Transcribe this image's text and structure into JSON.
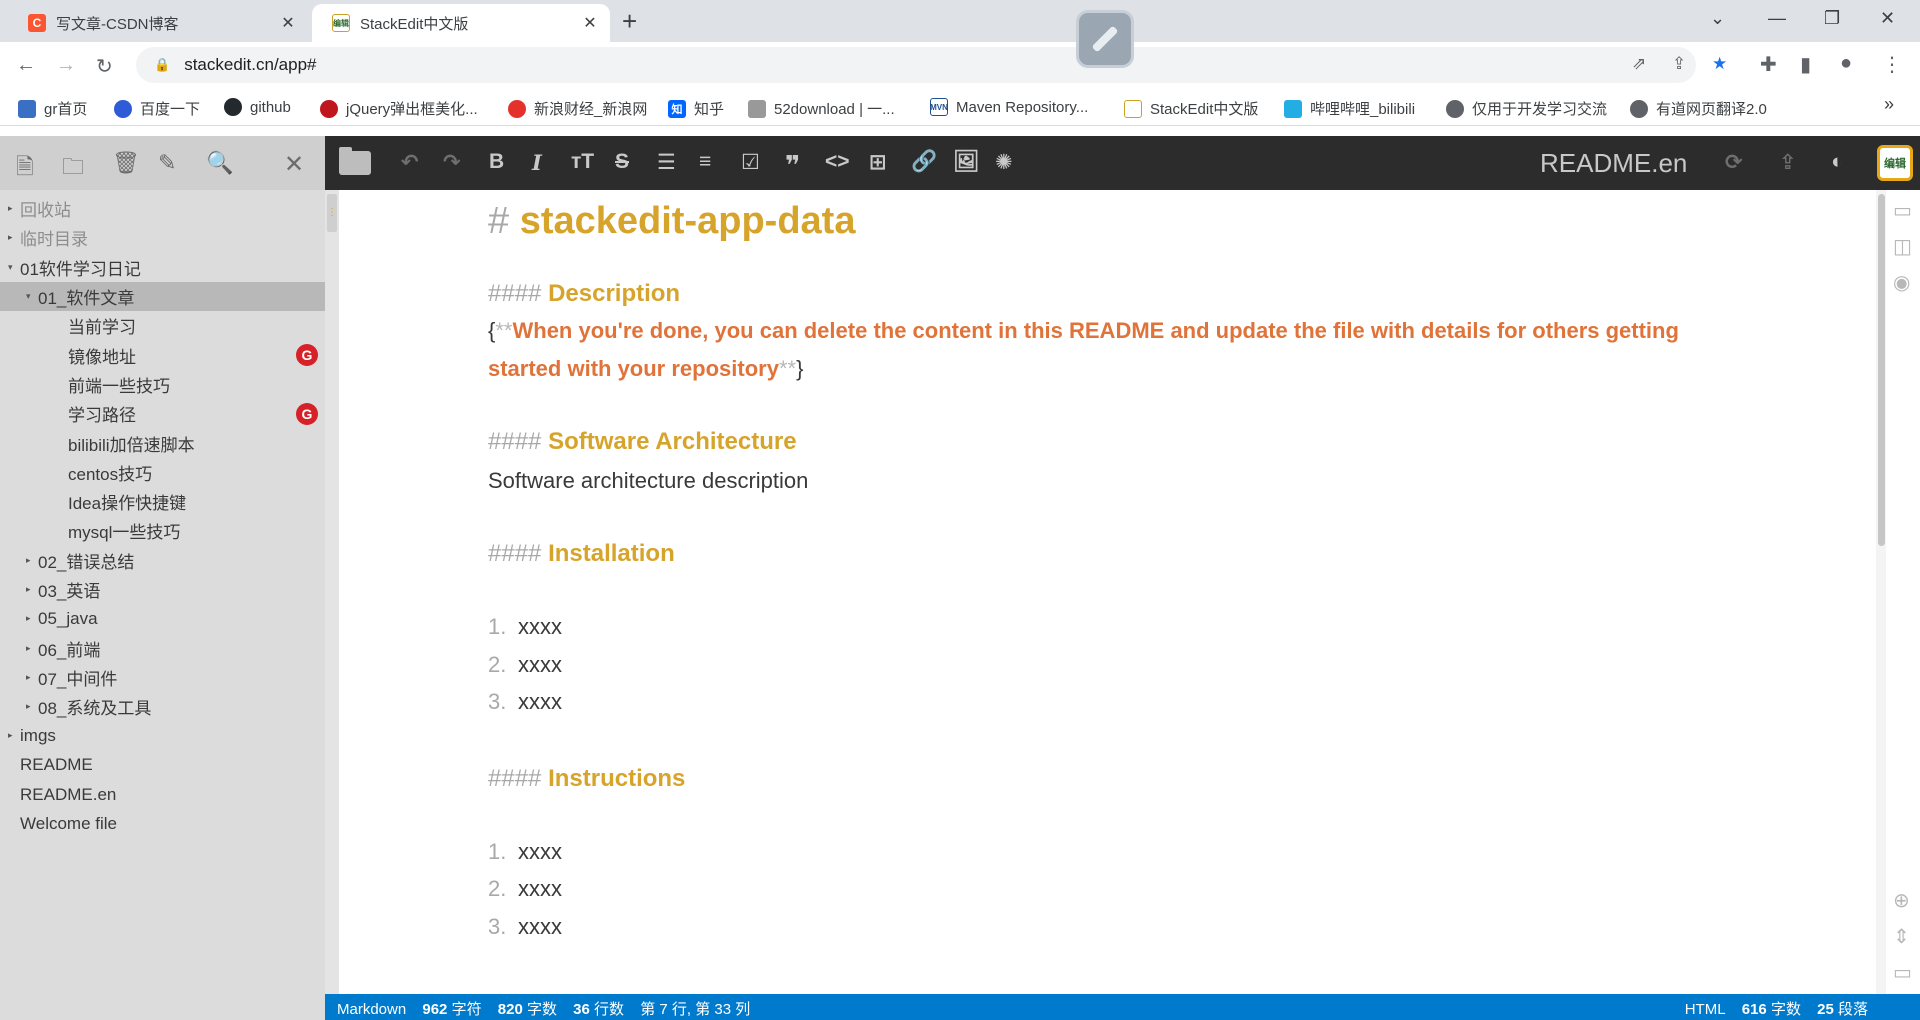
{
  "browser": {
    "tabs": [
      {
        "title": "写文章-CSDN博客",
        "favicon": "C"
      },
      {
        "title": "StackEdit中文版",
        "favicon": "编辑"
      }
    ],
    "url": "stackedit.cn/app#",
    "bookmarks": [
      {
        "label": "gr首页"
      },
      {
        "label": "百度一下"
      },
      {
        "label": "github"
      },
      {
        "label": "jQuery弹出框美化..."
      },
      {
        "label": "新浪财经_新浪网"
      },
      {
        "label": "知乎",
        "icon_text": "知"
      },
      {
        "label": "52download | 一..."
      },
      {
        "label": "Maven Repository...",
        "icon_text": "MVN"
      },
      {
        "label": "StackEdit中文版"
      },
      {
        "label": "哔哩哔哩_bilibili"
      },
      {
        "label": "仅用于开发学习交流"
      },
      {
        "label": "有道网页翻译2.0"
      }
    ],
    "overflow": "»"
  },
  "sidebar": {
    "tree": [
      {
        "label": "回收站",
        "level": 0,
        "caret": "▸",
        "muted": true
      },
      {
        "label": "临时目录",
        "level": 0,
        "caret": "▸",
        "muted": true
      },
      {
        "label": "01软件学习日记",
        "level": 0,
        "caret": "▾"
      },
      {
        "label": "01_软件文章",
        "level": 1,
        "caret": "▾",
        "selected": true
      },
      {
        "label": "当前学习",
        "level": 2
      },
      {
        "label": "镜像地址",
        "level": 2,
        "badge": "G"
      },
      {
        "label": "前端一些技巧",
        "level": 2
      },
      {
        "label": "学习路径",
        "level": 2,
        "badge": "G"
      },
      {
        "label": "bilibili加倍速脚本",
        "level": 2
      },
      {
        "label": "centos技巧",
        "level": 2
      },
      {
        "label": "Idea操作快捷键",
        "level": 2
      },
      {
        "label": "mysql一些技巧",
        "level": 2
      },
      {
        "label": "02_错误总结",
        "level": 1,
        "caret": "▸"
      },
      {
        "label": "03_英语",
        "level": 1,
        "caret": "▸"
      },
      {
        "label": "05_java",
        "level": 1,
        "caret": "▸"
      },
      {
        "label": "06_前端",
        "level": 1,
        "caret": "▸"
      },
      {
        "label": "07_中间件",
        "level": 1,
        "caret": "▸"
      },
      {
        "label": "08_系统及工具",
        "level": 1,
        "caret": "▸"
      },
      {
        "label": "imgs",
        "level": 0,
        "caret": "▸"
      },
      {
        "label": "README",
        "level": 0
      },
      {
        "label": "README.en",
        "level": 0
      },
      {
        "label": "Welcome file",
        "level": 0
      }
    ]
  },
  "navbar": {
    "doc_title": "README.en",
    "badge_text": "编辑"
  },
  "editor": {
    "h1_hash": "#",
    "h1": "stackedit-app-data",
    "h4_hash": "####",
    "sections": {
      "description": "Description",
      "architecture": "Software Architecture",
      "installation": "Installation",
      "instructions": "Instructions"
    },
    "desc_open": "{",
    "desc_mark": "**",
    "desc_line1": "When you're done, you can delete the content in this README and update the file with details for others getting",
    "desc_line2": "started with your repository",
    "desc_close": "}",
    "architecture_text": "Software architecture description",
    "install_items": [
      {
        "num": "1.",
        "text": "xxxx"
      },
      {
        "num": "2.",
        "text": "xxxx"
      },
      {
        "num": "3.",
        "text": "xxxx"
      }
    ],
    "instruction_items": [
      {
        "num": "1.",
        "text": "xxxx"
      },
      {
        "num": "2.",
        "text": "xxxx"
      },
      {
        "num": "3.",
        "text": "xxxx"
      }
    ]
  },
  "status": {
    "mode": "Markdown",
    "chars": "962",
    "chars_label": "字符",
    "words": "820",
    "words_label": "字数",
    "lines": "36",
    "lines_label": "行数",
    "position": "第 7 行, 第 33 列",
    "right_mode": "HTML",
    "right_words": "616",
    "right_words_label": "字数",
    "right_paras": "25",
    "right_paras_label": "段落"
  },
  "colors": {
    "heading": "#d7a42b",
    "strong": "#e0733a",
    "statusbar": "#007acc",
    "navbar": "#2c2c2c",
    "sidebar": "#dcdcdc"
  }
}
